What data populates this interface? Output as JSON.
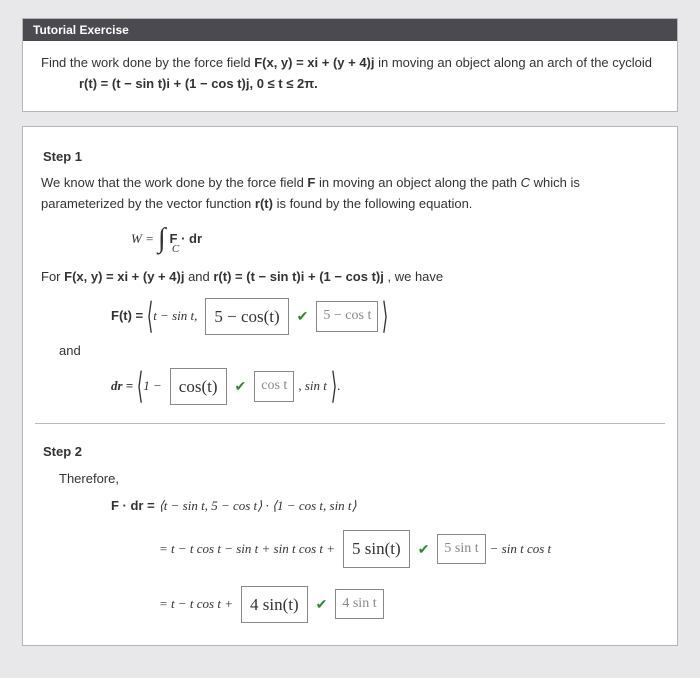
{
  "tutorial": {
    "header": "Tutorial Exercise",
    "prompt_a": "Find the work done by the force field  ",
    "prompt_f": "F(x, y) = xi + (y + 4)j",
    "prompt_b": "  in moving an object along an arch of the cycloid",
    "rline": "r(t) = (t − sin t)i + (1 − cos t)j,  0 ≤ t ≤ 2π."
  },
  "step1": {
    "title": "Step 1",
    "intro_a": "We know that the work done by the force field ",
    "intro_F": "F",
    "intro_b": " in moving an object along the path ",
    "intro_C": "C",
    "intro_c": " which is parameterized by the vector function ",
    "intro_r": "r(t)",
    "intro_d": " is found by the following equation.",
    "eq_W": "W =",
    "sub_C": "C",
    "eq_int": "F · dr",
    "for_a": "For  ",
    "for_F": "F(x, y) = xi + (y + 4)j",
    "for_b": "  and  ",
    "for_r": "r(t) = (t − sin t)i + (1 − cos t)j",
    "for_c": ",  we have",
    "Ft_lhs": "F(t) =",
    "Ft_first": "t − sin t,",
    "Ft_ans": "5 − cos(t)",
    "Ft_hint": "5 − cos  t",
    "and": "and",
    "dr_lhs": "dr =",
    "dr_first": "1 −",
    "dr_ans": "cos(t)",
    "dr_hint_num": "cos  t",
    "dr_tail": ",  sin t"
  },
  "step2": {
    "title": "Step 2",
    "therefore": "Therefore,",
    "fdr_lhs": "F · dr  =",
    "fdr_rhs": "⟨t − sin t, 5 − cos t⟩ · ⟨1 − cos t, sin t⟩",
    "line2_pre": "=  t − t cos t − sin t + sin t cos t +",
    "line2_ans": "5 sin(t)",
    "line2_hint": "5 sin  t",
    "line2_post": "− sin t cos t",
    "line3_pre": "=  t − t cos t +",
    "line3_ans": "4 sin(t)",
    "line3_hint": "4 sin  t"
  }
}
